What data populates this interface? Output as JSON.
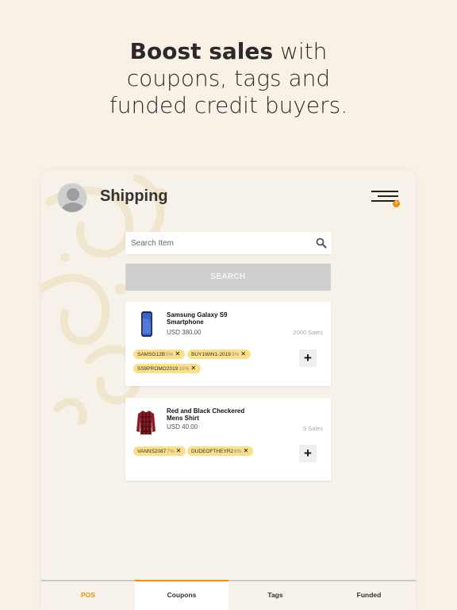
{
  "headline": {
    "bold": "Boost sales",
    "line1_rest": " with",
    "line2": "coupons, tags and",
    "line3": "funded credit buyers."
  },
  "header": {
    "title": "Shipping",
    "menu_badge": "3"
  },
  "search": {
    "placeholder": "Search Item",
    "button_label": "SEARCH"
  },
  "products": [
    {
      "name": "Samsung Galaxy S9 Smartphone",
      "price": "USD 380.00",
      "sales": "2000 Sales",
      "tags": [
        {
          "code": "SAMSG12B",
          "pct": "5%"
        },
        {
          "code": "BUY1WIN1-2019",
          "pct": "3%"
        },
        {
          "code": "SS9PROMO2019",
          "pct": "10%"
        }
      ]
    },
    {
      "name": "Red and Black Checkered Mens Shirt",
      "price": "USD 40.00",
      "sales": "0 Sales",
      "tags": [
        {
          "code": "VANNS2087",
          "pct": "7%"
        },
        {
          "code": "DUDEOFTHEYR2",
          "pct": "6%"
        }
      ]
    }
  ],
  "tabs": [
    {
      "label": "POS"
    },
    {
      "label": "Coupons"
    },
    {
      "label": "Tags"
    },
    {
      "label": "Funded"
    }
  ],
  "colors": {
    "accent": "#f29100",
    "tag_bg": "#fbe08a",
    "page_bg": "#f9f1e6"
  }
}
